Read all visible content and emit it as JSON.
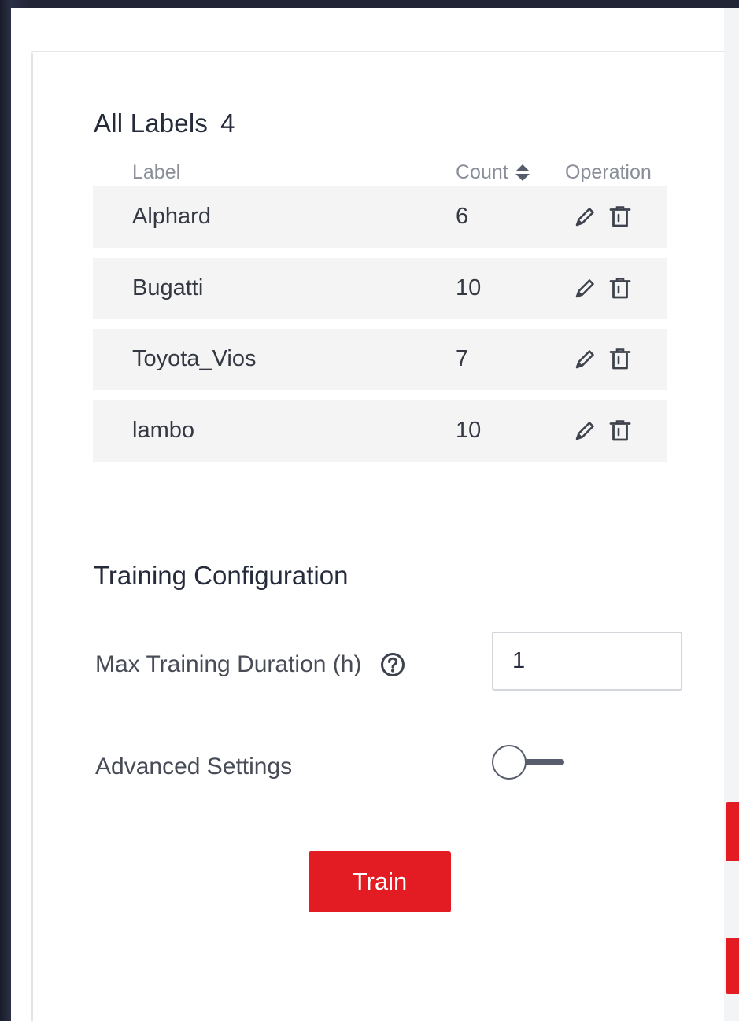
{
  "labels_section": {
    "title": "All Labels",
    "total": "4",
    "columns": {
      "label": "Label",
      "count": "Count",
      "operation": "Operation"
    },
    "rows": [
      {
        "label": "Alphard",
        "count": "6"
      },
      {
        "label": "Bugatti",
        "count": "10"
      },
      {
        "label": "Toyota_Vios",
        "count": "7"
      },
      {
        "label": "lambo",
        "count": "10"
      }
    ]
  },
  "training_config": {
    "title": "Training Configuration",
    "max_duration_label": "Max Training Duration (h)",
    "max_duration_value": "1",
    "advanced_settings_label": "Advanced Settings",
    "advanced_settings_enabled": false,
    "train_button": "Train"
  },
  "icons": {
    "edit": "pencil-icon",
    "delete": "trash-icon",
    "help": "question-circle-icon",
    "sort": "sort-caret-icon"
  },
  "colors": {
    "accent": "#e31b23",
    "row_background": "#f4f4f4",
    "text_primary": "#252b3a",
    "text_secondary": "#8a8e99"
  }
}
